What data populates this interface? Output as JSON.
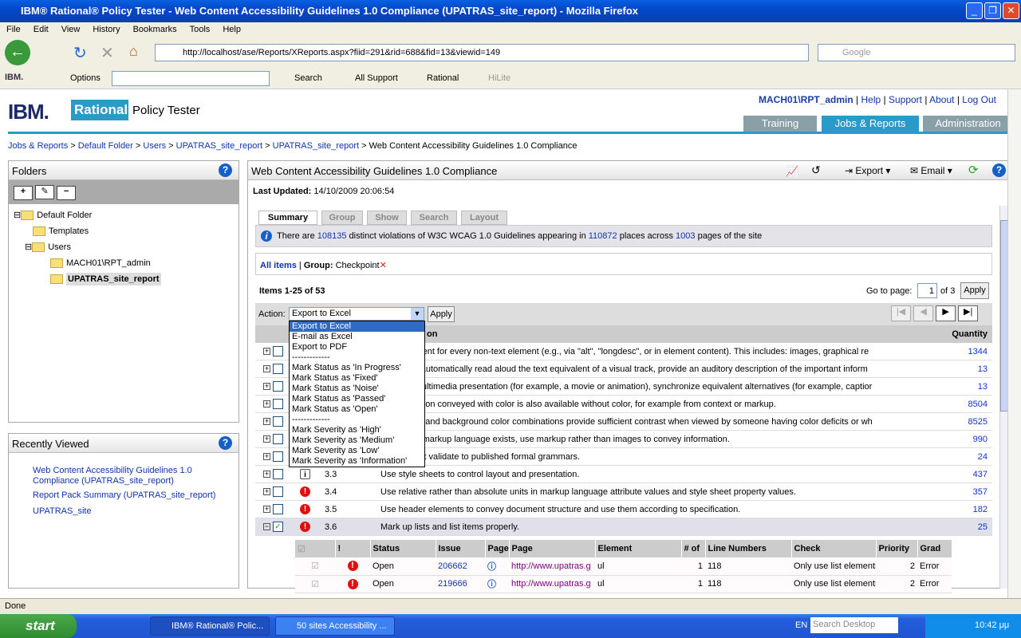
{
  "window": {
    "title": "IBM® Rational® Policy Tester - Web Content Accessibility Guidelines 1.0 Compliance (UPATRAS_site_report) - Mozilla Firefox"
  },
  "menu": [
    "File",
    "Edit",
    "View",
    "History",
    "Bookmarks",
    "Tools",
    "Help"
  ],
  "browser": {
    "url": "http://localhost/ase/Reports/XReports.aspx?fiid=291&rid=688&fid=13&viewid=149",
    "search_placeholder": "Google",
    "tb_options": "Options",
    "tb_search": "Search",
    "tb_support": "All Support",
    "tb_rational": "Rational",
    "tb_hilite": "HiLite",
    "ibm": "IBM."
  },
  "header": {
    "logo": "IBM.",
    "rational": "Rational.",
    "product": "Policy Tester",
    "links": [
      "MACH01\\RPT_admin",
      "Help",
      "Support",
      "About",
      "Log Out"
    ],
    "tabs": [
      "Training",
      "Jobs & Reports",
      "Administration"
    ]
  },
  "breadcrumb": [
    "Jobs & Reports",
    "Default Folder",
    "Users",
    "UPATRAS_site_report",
    "UPATRAS_site_report",
    "Web Content Accessibility Guidelines 1.0 Compliance"
  ],
  "folders": {
    "title": "Folders",
    "tree": [
      "Default Folder",
      "Templates",
      "Users",
      "MACH01\\RPT_admin",
      "UPATRAS_site_report"
    ]
  },
  "recent": {
    "title": "Recently Viewed",
    "items": [
      "Web Content Accessibility Guidelines 1.0 Compliance (UPATRAS_site_report)",
      "Report Pack Summary (UPATRAS_site_report)",
      "UPATRAS_site"
    ]
  },
  "report": {
    "title": "Web Content Accessibility Guidelines 1.0 Compliance",
    "export": "Export",
    "email": "Email",
    "last_updated_label": "Last Updated:",
    "last_updated": "14/10/2009 20:06:54",
    "tabs": [
      "Summary",
      "Group",
      "Show",
      "Search",
      "Layout"
    ],
    "info": {
      "pre": "There are",
      "v1": "108135",
      "mid1": "distinct violations of W3C WCAG 1.0 Guidelines appearing in",
      "v2": "110872",
      "mid2": "places across",
      "v3": "1003",
      "post": "pages of the site"
    },
    "all_items": "All items",
    "group_label": "Group:",
    "group_value": "Checkpoint",
    "items_label": "Items 1-25 of 53",
    "goto_label": "Go to page:",
    "page": "1",
    "of_pages": "of 3",
    "apply": "Apply",
    "action_label": "Action:",
    "action_value": "Export to Excel",
    "col_desc": "on",
    "col_qty": "Quantity",
    "dropdown": [
      "Export to Excel",
      "E-mail as Excel",
      "Export to PDF",
      "-------------",
      "Mark Status as 'In Progress'",
      "Mark Status as 'Fixed'",
      "Mark Status as 'Noise'",
      "Mark Status as 'Passed'",
      "Mark Status as 'Open'",
      "-------------",
      "Mark Severity as 'High'",
      "Mark Severity as 'Medium'",
      "Mark Severity as 'Low'",
      "Mark Severity as 'Information'"
    ],
    "rows": [
      {
        "num": "",
        "desc": "ext equivalent for every non-text element (e.g., via \"alt\", \"longdesc\", or in element content). This includes: images, graphical re",
        "qty": "1344"
      },
      {
        "num": "",
        "desc": "gents can automatically read aloud the text equivalent of a visual track, provide an auditory description of the important inform",
        "qty": "13"
      },
      {
        "num": "",
        "desc": "e-based multimedia presentation (for example, a movie or animation), synchronize equivalent alternatives (for example, captior",
        "qty": "13"
      },
      {
        "num": "",
        "desc": "all information conveyed with color is also available without color, for example from context or markup.",
        "qty": "8504"
      },
      {
        "num": "",
        "desc": "foreground and background color combinations provide sufficient contrast when viewed by someone having color deficits or wh",
        "qty": "8525"
      },
      {
        "num": "",
        "desc": "ppropriate markup language exists, use markup rather than images to convey information.",
        "qty": "990"
      },
      {
        "num": "",
        "desc": "uments that validate to published formal grammars.",
        "qty": "24"
      },
      {
        "num": "3.3",
        "desc": "Use style sheets to control layout and presentation.",
        "qty": "437",
        "sev": "info"
      },
      {
        "num": "3.4",
        "desc": "Use relative rather than absolute units in markup language attribute values and style sheet property values.",
        "qty": "357"
      },
      {
        "num": "3.5",
        "desc": "Use header elements to convey document structure and use them according to specification.",
        "qty": "182"
      },
      {
        "num": "3.6",
        "desc": "Mark up lists and list items properly.",
        "qty": "25",
        "expanded": true
      }
    ],
    "sub_cols": [
      "!",
      "Status",
      "Issue",
      "Page",
      "Page",
      "Element",
      "# of",
      "Line Numbers",
      "Check",
      "Priority",
      "Grad"
    ],
    "sub_rows": [
      {
        "status": "Open",
        "issue": "206662",
        "page": "http://www.upatras.g",
        "element": "ul",
        "count": "1",
        "line": "118",
        "check": "Only use list elements",
        "priority": "2",
        "grade": "Error"
      },
      {
        "status": "Open",
        "issue": "219666",
        "page": "http://www.upatras.g",
        "element": "ul",
        "count": "1",
        "line": "118",
        "check": "Only use list elements",
        "priority": "2",
        "grade": "Error"
      }
    ]
  },
  "status": "Done",
  "taskbar": {
    "start": "start",
    "tasks": [
      "IBM® Rational® Polic...",
      "50 sites Accessibility ..."
    ],
    "lang": "EN",
    "search": "Search Desktop",
    "time": "10:42 μμ"
  }
}
